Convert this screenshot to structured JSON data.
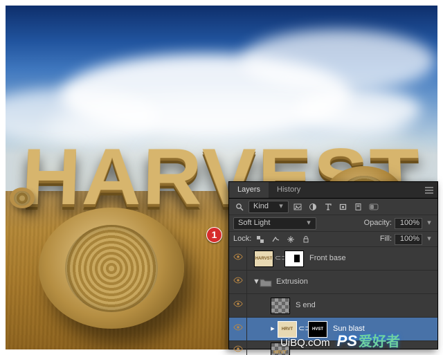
{
  "scene": {
    "word": "HARVEST"
  },
  "callout": {
    "num": "1"
  },
  "panel": {
    "tabs": {
      "layers": "Layers",
      "history": "History"
    },
    "filter": {
      "kind_label": "Kind"
    },
    "blend": {
      "mode": "Soft Light",
      "opacity_label": "Opacity:",
      "opacity_value": "100%"
    },
    "lock": {
      "label": "Lock:",
      "fill_label": "Fill:",
      "fill_value": "100%"
    },
    "layers": [
      {
        "name": "Front base"
      },
      {
        "name": "Extrusion"
      },
      {
        "name": "S end"
      },
      {
        "name": "Sun blast"
      }
    ]
  },
  "watermark": {
    "url": "UiBQ.cOm",
    "prefix": "PS",
    "cn": "爱好者"
  }
}
